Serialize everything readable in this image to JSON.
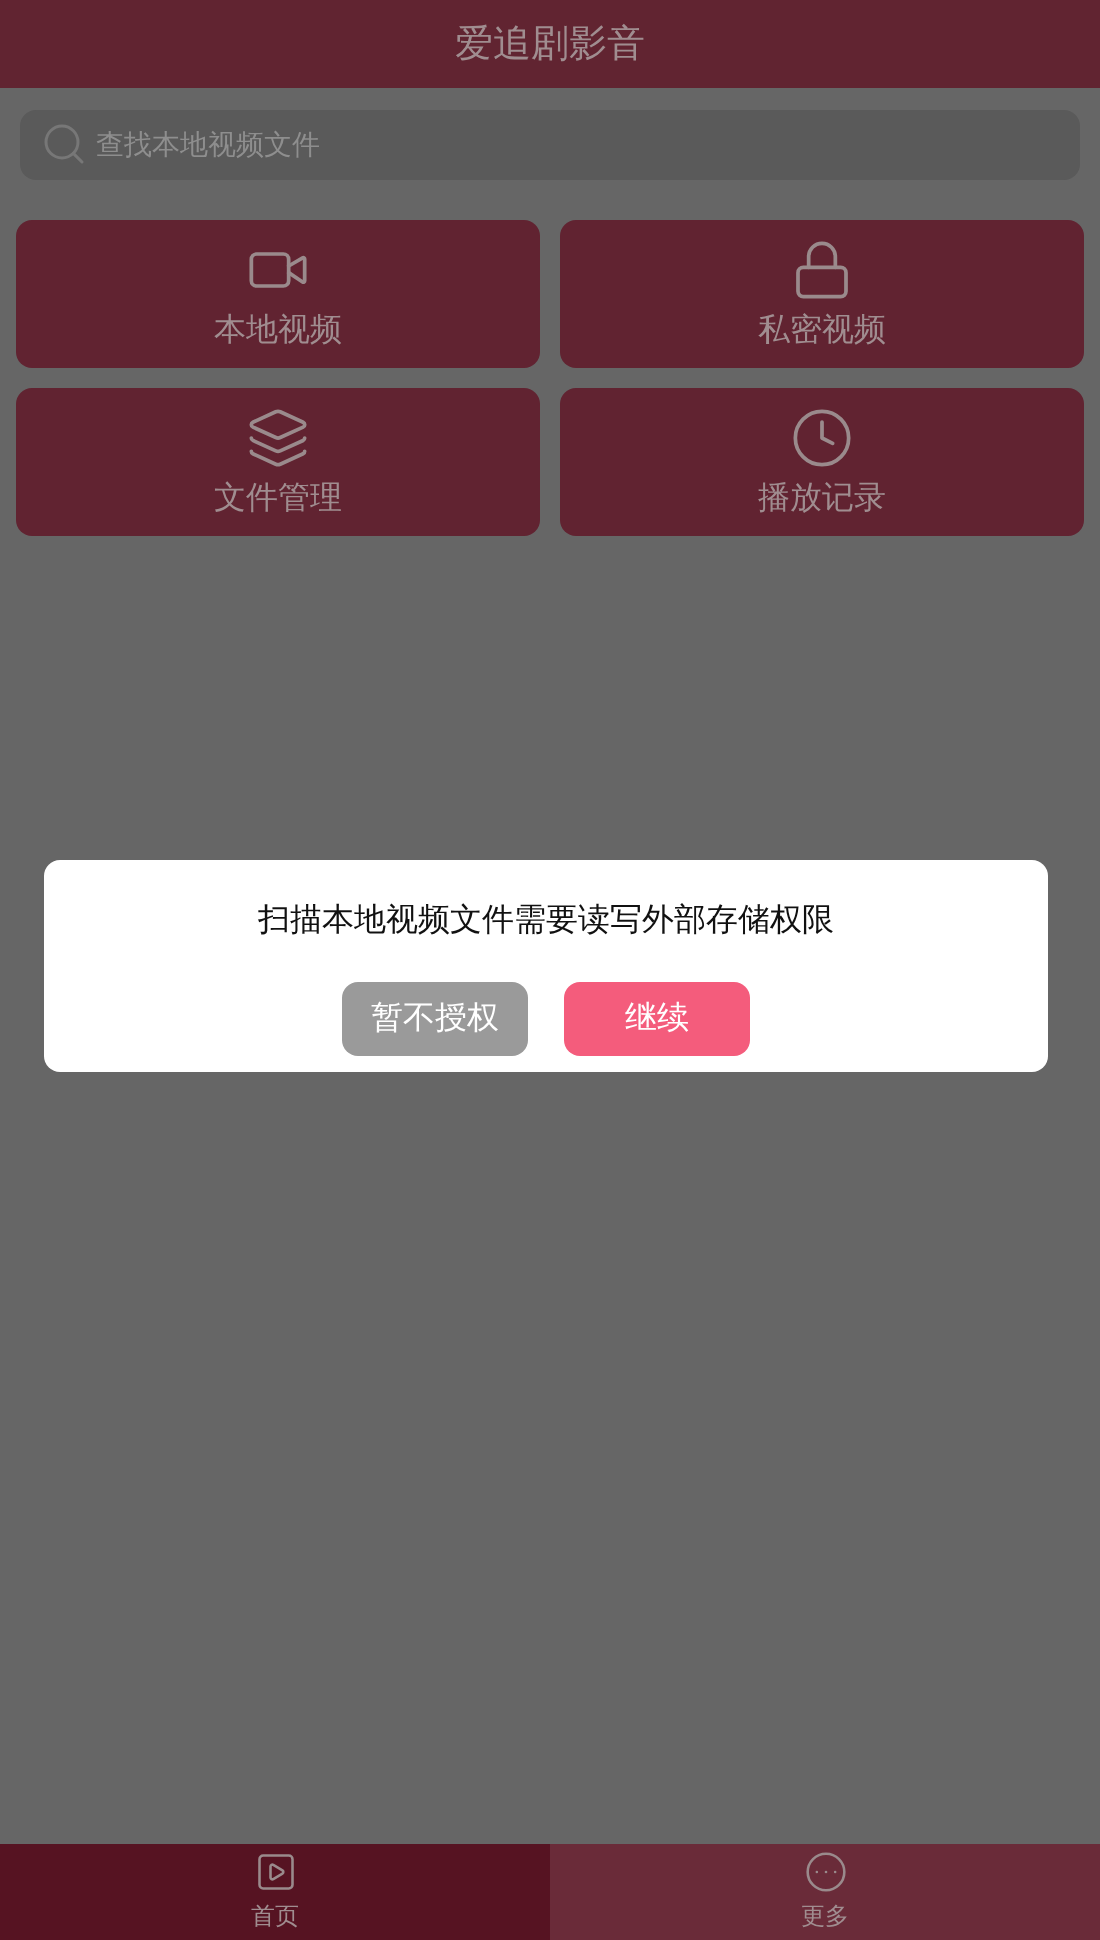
{
  "header": {
    "title": "爱追剧影音"
  },
  "search": {
    "placeholder": "查找本地视频文件"
  },
  "tiles": [
    {
      "kind": "video",
      "label": "本地视频"
    },
    {
      "kind": "lock",
      "label": "私密视频"
    },
    {
      "kind": "layers",
      "label": "文件管理"
    },
    {
      "kind": "clock",
      "label": "播放记录"
    }
  ],
  "dialog": {
    "message": "扫描本地视频文件需要读写外部存储权限",
    "buttons": [
      {
        "kind": "secondary",
        "label": "暂不授权"
      },
      {
        "kind": "primary",
        "label": "继续"
      }
    ]
  },
  "tabs": [
    {
      "kind": "home",
      "label": "首页",
      "selected": true
    },
    {
      "kind": "more",
      "label": "更多",
      "selected": false
    }
  ]
}
